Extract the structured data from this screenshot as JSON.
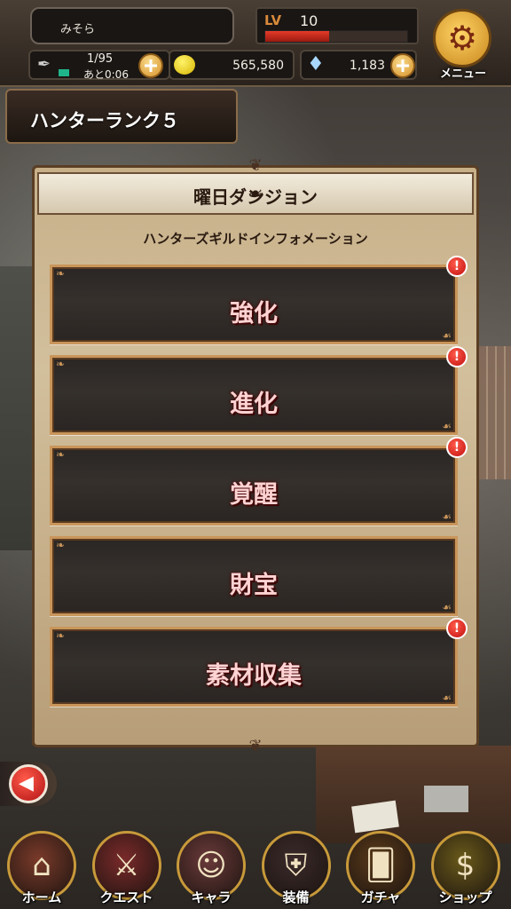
{
  "player": {
    "name": "みそら",
    "level_label": "LV",
    "level": "10",
    "exp_fraction": 0.45
  },
  "stamina": {
    "value": "1/95",
    "timer": "あと0:06"
  },
  "gold": {
    "value": "565,580"
  },
  "gems": {
    "value": "1,183"
  },
  "menu": {
    "label": "メニュー"
  },
  "rank": {
    "label": "ハンターランク５"
  },
  "panel": {
    "title": "曜日ダンジョン",
    "subtitle": "ハンターズギルドインフォメーション"
  },
  "dungeons": [
    {
      "label": "強化",
      "has_alert": true
    },
    {
      "label": "進化",
      "has_alert": true
    },
    {
      "label": "覚醒",
      "has_alert": true
    },
    {
      "label": "財宝",
      "has_alert": false
    },
    {
      "label": "素材収集",
      "has_alert": true
    }
  ],
  "alert_symbol": "!",
  "nav": [
    {
      "label": "ホーム",
      "icon": "home-icon"
    },
    {
      "label": "クエスト",
      "icon": "crossed-swords-icon"
    },
    {
      "label": "キャラ",
      "icon": "character-icon"
    },
    {
      "label": "装備",
      "icon": "equipment-icon"
    },
    {
      "label": "ガチャ",
      "icon": "gacha-icon"
    },
    {
      "label": "ショップ",
      "icon": "shop-icon"
    }
  ],
  "colors": {
    "accent_gold": "#c9955a",
    "alert_red": "#c21010",
    "label_pink": "#ffd3d3"
  }
}
